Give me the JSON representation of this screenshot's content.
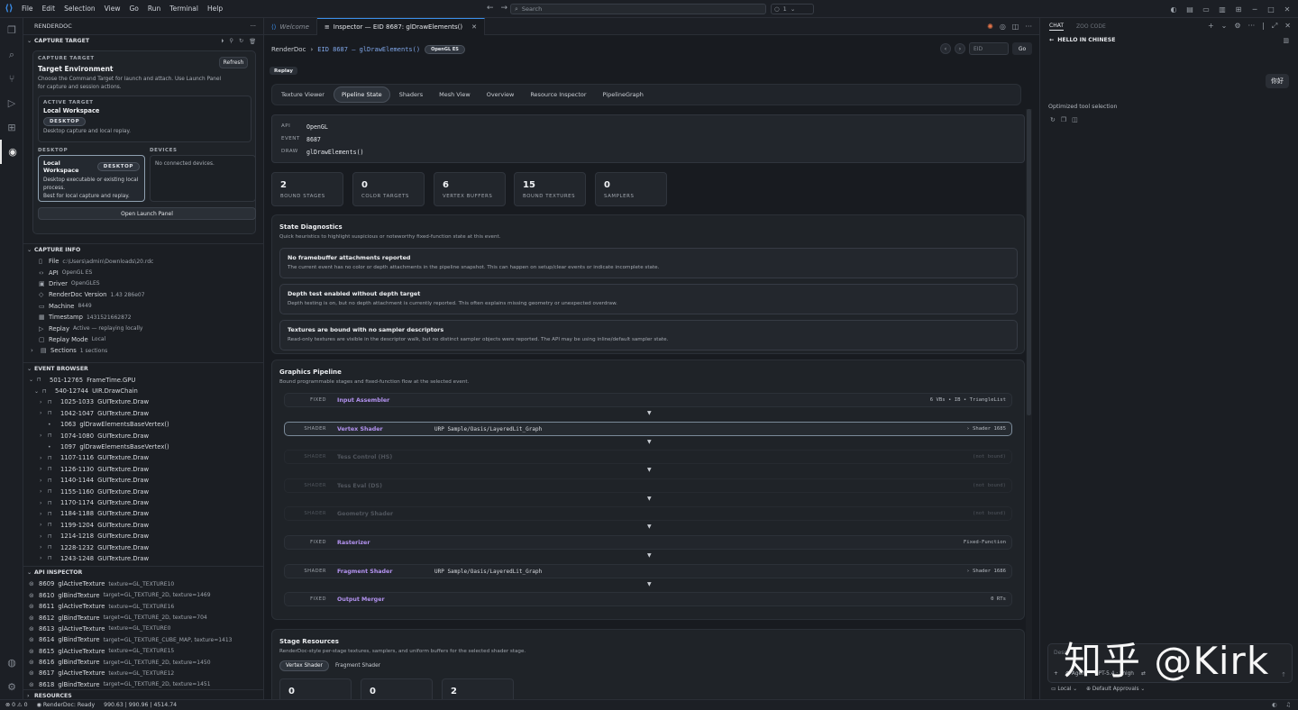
{
  "titlebar": {
    "menu": [
      "File",
      "Edit",
      "Selection",
      "View",
      "Go",
      "Run",
      "Terminal",
      "Help"
    ],
    "search_placeholder": "Search",
    "agent_count": "1"
  },
  "sidebar": {
    "title": "RENDERDOC",
    "capture_target": {
      "section": "CAPTURE TARGET",
      "eyebrow": "CAPTURE TARGET",
      "title": "Target Environment",
      "refresh": "Refresh",
      "description": "Choose the Command Target for launch and attach. Use Launch Panel for capture and session actions.",
      "active_eyebrow": "ACTIVE TARGET",
      "active_title": "Local Workspace",
      "active_badge": "DESKTOP",
      "active_desc": "Desktop capture and local replay.",
      "desktop_label": "DESKTOP",
      "devices_label": "DEVICES",
      "ws_title": "Local Workspace",
      "ws_badge": "DESKTOP",
      "ws_desc1": "Desktop executable or existing local process.",
      "ws_desc2": "Best for local capture and replay.",
      "no_devices": "No connected devices.",
      "open_launch": "Open Launch Panel"
    },
    "capture_info": {
      "section": "CAPTURE INFO",
      "rows": [
        {
          "label": "File",
          "value": "c:\\Users\\admin\\Downloads\\20.rdc"
        },
        {
          "label": "API",
          "value": "OpenGL ES"
        },
        {
          "label": "Driver",
          "value": "OpenGLES"
        },
        {
          "label": "RenderDoc Version",
          "value": "1.43 286e07"
        },
        {
          "label": "Machine",
          "value": "8449"
        },
        {
          "label": "Timestamp",
          "value": "1431521662872"
        },
        {
          "label": "Replay",
          "value": "Active — replaying locally"
        },
        {
          "label": "Replay Mode",
          "value": "Local"
        },
        {
          "label": "Sections",
          "value": "1 sections"
        }
      ]
    },
    "event_browser": {
      "section": "EVENT BROWSER",
      "root": {
        "range": "501-12765",
        "name": "FrameTime.GPU"
      },
      "child": {
        "range": "540-12744",
        "name": "UIR.DrawChain"
      },
      "items": [
        {
          "range": "1025-1033",
          "name": "GUITexture.Draw",
          "expand": true
        },
        {
          "range": "1042-1047",
          "name": "GUITexture.Draw",
          "expand": true
        },
        {
          "range": "1063",
          "name": "glDrawElementsBaseVertex()",
          "expand": false
        },
        {
          "range": "1074-1080",
          "name": "GUITexture.Draw",
          "expand": true
        },
        {
          "range": "1097",
          "name": "glDrawElementsBaseVertex()",
          "expand": false
        },
        {
          "range": "1107-1116",
          "name": "GUITexture.Draw",
          "expand": true
        },
        {
          "range": "1126-1130",
          "name": "GUITexture.Draw",
          "expand": true
        },
        {
          "range": "1140-1144",
          "name": "GUITexture.Draw",
          "expand": true
        },
        {
          "range": "1155-1160",
          "name": "GUITexture.Draw",
          "expand": true
        },
        {
          "range": "1170-1174",
          "name": "GUITexture.Draw",
          "expand": true
        },
        {
          "range": "1184-1188",
          "name": "GUITexture.Draw",
          "expand": true
        },
        {
          "range": "1199-1204",
          "name": "GUITexture.Draw",
          "expand": true
        },
        {
          "range": "1214-1218",
          "name": "GUITexture.Draw",
          "expand": true
        },
        {
          "range": "1228-1232",
          "name": "GUITexture.Draw",
          "expand": true
        },
        {
          "range": "1243-1248",
          "name": "GUITexture.Draw",
          "expand": true
        }
      ]
    },
    "api_inspector": {
      "section": "API INSPECTOR",
      "rows": [
        {
          "id": "8609",
          "fn": "glActiveTexture",
          "params": "texture=GL_TEXTURE10"
        },
        {
          "id": "8610",
          "fn": "glBindTexture",
          "params": "target=GL_TEXTURE_2D, texture=1469"
        },
        {
          "id": "8611",
          "fn": "glActiveTexture",
          "params": "texture=GL_TEXTURE16"
        },
        {
          "id": "8612",
          "fn": "glBindTexture",
          "params": "target=GL_TEXTURE_2D, texture=704"
        },
        {
          "id": "8613",
          "fn": "glActiveTexture",
          "params": "texture=GL_TEXTURE0"
        },
        {
          "id": "8614",
          "fn": "glBindTexture",
          "params": "target=GL_TEXTURE_CUBE_MAP, texture=1413"
        },
        {
          "id": "8615",
          "fn": "glActiveTexture",
          "params": "texture=GL_TEXTURE15"
        },
        {
          "id": "8616",
          "fn": "glBindTexture",
          "params": "target=GL_TEXTURE_2D, texture=1450"
        },
        {
          "id": "8617",
          "fn": "glActiveTexture",
          "params": "texture=GL_TEXTURE12"
        },
        {
          "id": "8618",
          "fn": "glBindTexture",
          "params": "target=GL_TEXTURE_2D, texture=1451"
        }
      ]
    },
    "resources": {
      "section": "RESOURCES"
    }
  },
  "tabs": {
    "welcome": "Welcome",
    "inspector": "Inspector — EID 8687: glDrawElements()"
  },
  "editor": {
    "breadcrumb_root": "RenderDoc",
    "breadcrumb_eid": "EID 8687 — glDrawElements()",
    "api_badge": "OpenGL ES",
    "eid_placeholder": "EID",
    "go": "Go",
    "replay": "Replay",
    "inner_tabs": [
      "Texture Viewer",
      "Pipeline State",
      "Shaders",
      "Mesh View",
      "Overview",
      "Resource Inspector",
      "PipelineGraph"
    ],
    "summary": {
      "api_key": "API",
      "api_val": "OpenGL",
      "event_key": "EVENT",
      "event_val": "8687",
      "draw_key": "DRAW",
      "draw_val": "glDrawElements()"
    },
    "stats": [
      {
        "num": "2",
        "label": "BOUND STAGES"
      },
      {
        "num": "0",
        "label": "COLOR TARGETS"
      },
      {
        "num": "6",
        "label": "VERTEX BUFFERS"
      },
      {
        "num": "15",
        "label": "BOUND TEXTURES"
      },
      {
        "num": "0",
        "label": "SAMPLERS"
      }
    ],
    "diagnostics": {
      "title": "State Diagnostics",
      "desc": "Quick heuristics to highlight suspicious or noteworthy fixed-function state at this event.",
      "items": [
        {
          "title": "No framebuffer attachments reported",
          "desc": "The current event has no color or depth attachments in the pipeline snapshot. This can happen on setup/clear events or indicate incomplete state."
        },
        {
          "title": "Depth test enabled without depth target",
          "desc": "Depth testing is on, but no depth attachment is currently reported. This often explains missing geometry or unexpected overdraw."
        },
        {
          "title": "Textures are bound with no sampler descriptors",
          "desc": "Read-only textures are visible in the descriptor walk, but no distinct sampler objects were reported. The API may be using inline/default sampler state."
        }
      ]
    },
    "pipeline": {
      "title": "Graphics Pipeline",
      "desc": "Bound programmable stages and fixed-function flow at the selected event.",
      "stages": [
        {
          "kind": "FIXED",
          "name": "Input Assembler",
          "program": "",
          "right": "6 VBs • IB • TriangleList",
          "state": "normal"
        },
        {
          "kind": "SHADER",
          "name": "Vertex Shader",
          "program": "URP Sample/Oasis/LayeredLit_Graph",
          "right": "› Shader 1685",
          "state": "selected"
        },
        {
          "kind": "SHADER",
          "name": "Tess Control (HS)",
          "program": "",
          "right": "(not bound)",
          "state": "dim"
        },
        {
          "kind": "SHADER",
          "name": "Tess Eval (DS)",
          "program": "",
          "right": "(not bound)",
          "state": "dim"
        },
        {
          "kind": "SHADER",
          "name": "Geometry Shader",
          "program": "",
          "right": "(not bound)",
          "state": "dim"
        },
        {
          "kind": "FIXED",
          "name": "Rasterizer",
          "program": "",
          "right": "Fixed-Function",
          "state": "normal"
        },
        {
          "kind": "SHADER",
          "name": "Fragment Shader",
          "program": "URP Sample/Oasis/LayeredLit_Graph",
          "right": "› Shader 1686",
          "state": "normal"
        },
        {
          "kind": "FIXED",
          "name": "Output Merger",
          "program": "",
          "right": "0 RTs",
          "state": "normal"
        }
      ],
      "arrow": "▼"
    },
    "stage_resources": {
      "title": "Stage Resources",
      "desc": "RenderDoc-style per-stage textures, samplers, and uniform buffers for the selected shader stage.",
      "tabs": [
        "Vertex Shader",
        "Fragment Shader"
      ],
      "stats": [
        "0",
        "0",
        "2"
      ]
    }
  },
  "chat": {
    "tab_chat": "CHAT",
    "tab_zoo": "ZOO CODE",
    "title": "HELLO IN CHINESE",
    "user_msg": "你好",
    "tool_note": "Optimized tool selection",
    "input_placeholder": "Desc",
    "agent": "Agent",
    "model": "GPT-5.4 · xhigh",
    "local": "Local",
    "approvals": "Default Approvals",
    "watermark": "知乎 @Kirk"
  },
  "statusbar": {
    "problems": "0 ⚠ 0",
    "ready": "RenderDoc: Ready",
    "metrics": "990.63 | 990.96 | 4514.74"
  },
  "colors": {
    "accent": "#3b8eea",
    "stage_name": "#b392f0",
    "background": "#181b20"
  }
}
